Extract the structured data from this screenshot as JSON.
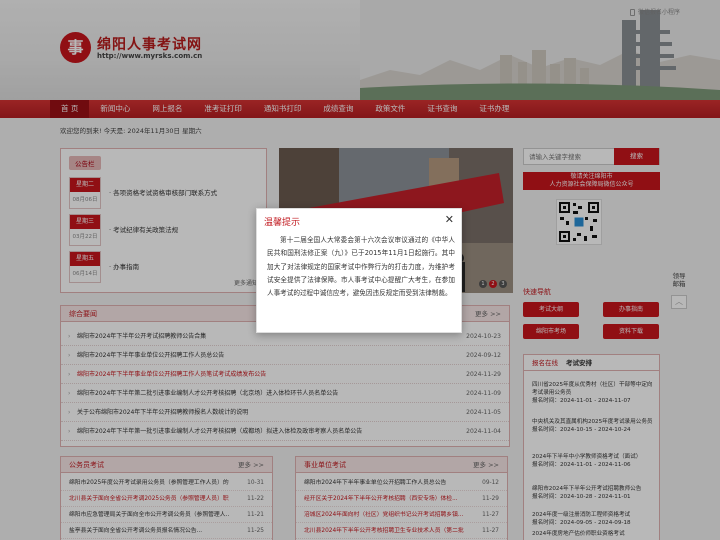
{
  "header": {
    "mini_program": "微信报名小程序",
    "logo_char": "事",
    "title": "绵阳人事考试网",
    "url": "http://www.myrsks.com.cn"
  },
  "nav": {
    "items": [
      "首 页",
      "新闻中心",
      "网上报名",
      "准考证打印",
      "通知书打印",
      "成绩查询",
      "政策文件",
      "证书查询",
      "证书办理"
    ],
    "active_index": 0
  },
  "welcome": "欢迎您的到来!  今天是: 2024年11月30日 星期六",
  "notice": {
    "tab": "公告栏",
    "items": [
      {
        "weekday": "星期二",
        "date": "08月06日",
        "text": "· 各项资格考试资格审核部门联系方式"
      },
      {
        "weekday": "星期三",
        "date": "03月22日",
        "text": "· 考试纪律有关政策法规"
      },
      {
        "weekday": "星期五",
        "date": "06月14日",
        "text": "· 办事指南"
      }
    ],
    "more": "更多通知"
  },
  "photo": {
    "dots": [
      "1",
      "2",
      "3"
    ],
    "active_dot": 1
  },
  "search": {
    "placeholder": "请输入关键字搜索",
    "button": "搜索"
  },
  "wechat": {
    "line1": "敬请关注绵阳市",
    "line2": "人力资源社会保障局微信公众号"
  },
  "side": {
    "links": "领导\n邮箱",
    "top": "︿"
  },
  "quick": {
    "title": "快速导航",
    "buttons": [
      "考试大纲",
      "办事指南",
      "绵阳市考场",
      "资料下载"
    ]
  },
  "comprehensive": {
    "title": "综合要闻",
    "more": "更多 >>",
    "rows": [
      {
        "text": "绵阳市2024年下半年公开考试招聘教师公告合集",
        "date": "2024-10-23",
        "highlight": false
      },
      {
        "text": "绵阳市2024年下半年事业单位公开招聘工作人员总公告",
        "date": "2024-09-12",
        "highlight": false
      },
      {
        "text": "绵阳市2024年下半年事业单位公开招聘工作人员笔试考试成绩发布公告",
        "date": "2024-11-29",
        "highlight": true
      },
      {
        "text": "绵阳市2024年下半年第二批引进事业编制人才公开考核招聘（北京场）进入体检环节人员名单公告",
        "date": "2024-11-09",
        "highlight": false
      },
      {
        "text": "关于公布绵阳市2024年下半年公开招聘教师报名人数统计的说明",
        "date": "2024-11-05",
        "highlight": false
      },
      {
        "text": "绵阳市2024年下半年第一批引进事业编制人才公开考核招聘（成都场）拟进入体检及政审考察人员名单公告",
        "date": "2024-11-04",
        "highlight": false
      }
    ]
  },
  "civil": {
    "title": "公务员考试",
    "more": "更多 >>",
    "rows": [
      {
        "text": "绵阳市2025年度公开考试录用公务员（参照管理工作人员）的...",
        "date": "10-31",
        "highlight": false
      },
      {
        "text": "北川县关于面向全省公开考调2025公务员（参照管理人员）职...",
        "date": "11-22",
        "highlight": true
      },
      {
        "text": "绵阳市应急管理局关于面向全市公开考调公务员（参照管理人...",
        "date": "11-21",
        "highlight": false
      },
      {
        "text": "盐亭县关于面向全省公开考调公务员报名情况公告...",
        "date": "11-25",
        "highlight": false
      }
    ]
  },
  "institution": {
    "title": "事业单位考试",
    "more": "更多 >>",
    "rows": [
      {
        "text": "绵阳市2024年下半年事业单位公开招聘工作人员总公告",
        "date": "09-12",
        "highlight": false
      },
      {
        "text": "经开区关于2024年下半年公开考核招聘（西安专场）体检...",
        "date": "11-29",
        "highlight": true
      },
      {
        "text": "涪城区2024年面向村（社区）党组织书记公开考试招聘乡镇...",
        "date": "11-27",
        "highlight": true
      },
      {
        "text": "北川县2024年下半年公开考核招聘卫生专业技术人员（第二批...",
        "date": "11-27",
        "highlight": true
      }
    ]
  },
  "registration": {
    "tabs": [
      "报名在线",
      "考试安排"
    ],
    "items": [
      {
        "text": "四川省2025年度从优秀村（社区）干部等中定向考试录用公务员",
        "period": "报名时间：2024-11-01 - 2024-11-07"
      },
      {
        "text": "中央机关及其直属机构2025年度考试录用公务员",
        "period": "报名时间：2024-10-15 - 2024-10-24"
      },
      {
        "text": "2024年下半年中小学教师资格考试（面试）",
        "period": "报名时间：2024-11-01 - 2024-11-06"
      },
      {
        "text": "绵阳市2024年下半年公开考试招聘教师公告",
        "period": "报名时间：2024-10-28 - 2024-11-01"
      },
      {
        "text": "2024年度一级注册消防工程师资格考试",
        "period": "报名时间：2024-09-05 - 2024-09-18"
      },
      {
        "text": "2024年度房地产估价师职业资格考试",
        "period": ""
      }
    ]
  },
  "modal": {
    "title": "温馨提示",
    "close": "✕",
    "body": "第十二届全国人大常委会第十六次会议审议通过的《中华人民共和国刑法修正案（九）》已于2015年11月1日起施行。其中加大了对法律规定的国家考试中作弊行为的打击力度，为维护考试安全提供了法律保障。市人事考试中心提醒广大考生，在参加人事考试的过程中诚信应考，避免因违反规定而受到法律制裁。"
  },
  "colors": {
    "brand": "#c8161d",
    "highlight_text": "#c8161d"
  }
}
